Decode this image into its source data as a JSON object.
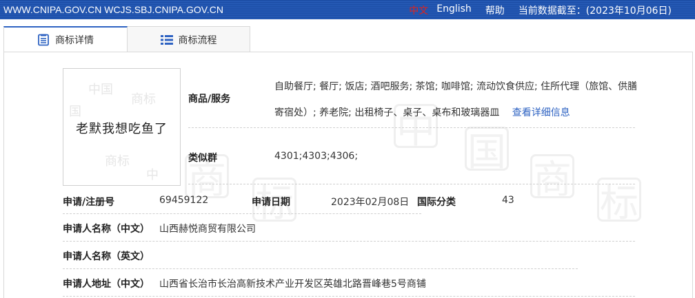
{
  "topbar": {
    "urls": "WWW.CNIPA.GOV.CN WCJS.SBJ.CNIPA.GOV.CN",
    "lang_zh": "中文",
    "lang_en": "English",
    "help": "帮助",
    "data_date": "当前数据截至：(2023年10月06日)"
  },
  "tabs": [
    {
      "label": "商标详情",
      "icon": "document-icon"
    },
    {
      "label": "商标流程",
      "icon": "list-icon"
    }
  ],
  "trademark": {
    "image_text": "老默我想吃鱼了"
  },
  "details": {
    "goods_label": "商品/服务",
    "goods_line1": "自助餐厅; 餐厅; 饭店; 酒吧服务; 茶馆; 咖啡馆; 流动饮食供应; 住所代理（旅馆、供膳",
    "goods_line2": "寄宿处）; 养老院; 出租椅子、桌子、桌布和玻璃器皿",
    "goods_more": "查看详细信息",
    "similar_label": "类似群",
    "similar_value": "4301;4303;4306;",
    "reg_label": "申请/注册号",
    "reg_value": "69459122",
    "date_label": "申请日期",
    "date_value": "2023年02月08日",
    "intl_label": "国际分类",
    "intl_value": "43",
    "name_cn_label": "申请人名称（中文）",
    "name_cn_value": "山西赫悦商贸有限公司",
    "name_en_label": "申请人名称（英文）",
    "name_en_value": "",
    "addr_cn_label": "申请人地址（中文）",
    "addr_cn_value": "山西省长治市长治高新技术产业开发区英雄北路晋峰巷5号商铺"
  },
  "colors": {
    "topbar": "#1d4fa8",
    "accent": "#2d62c2",
    "active_lang": "#e2231a"
  }
}
